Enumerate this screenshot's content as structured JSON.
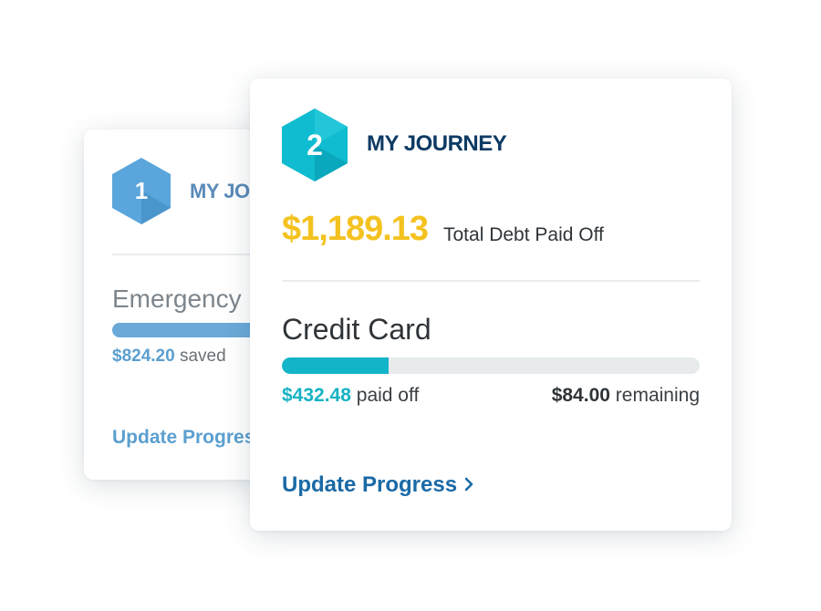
{
  "back_card": {
    "step_number": "1",
    "title": "MY JOURNEY",
    "category": "Emergency",
    "saved_amount": "$824.20",
    "saved_label": "saved",
    "update_label": "Update Progress",
    "hex_color": "#5aa5db"
  },
  "front_card": {
    "step_number": "2",
    "title": "MY JOURNEY",
    "total_amount": "$1,189.13",
    "total_label": "Total Debt Paid Off",
    "category": "Credit Card",
    "progress_fraction": 0.255,
    "paid_amount": "$432.48",
    "paid_label": "paid off",
    "remaining_amount": "$84.00",
    "remaining_label": "remaining",
    "update_label": "Update Progress",
    "update_icon": "chevron-right-icon",
    "hex_color": "#10bccf"
  },
  "colors": {
    "total_amount": "#f4c21f",
    "title": "#0d3a63",
    "progress_fill": "#12b4c8",
    "link": "#1a6aa6"
  }
}
